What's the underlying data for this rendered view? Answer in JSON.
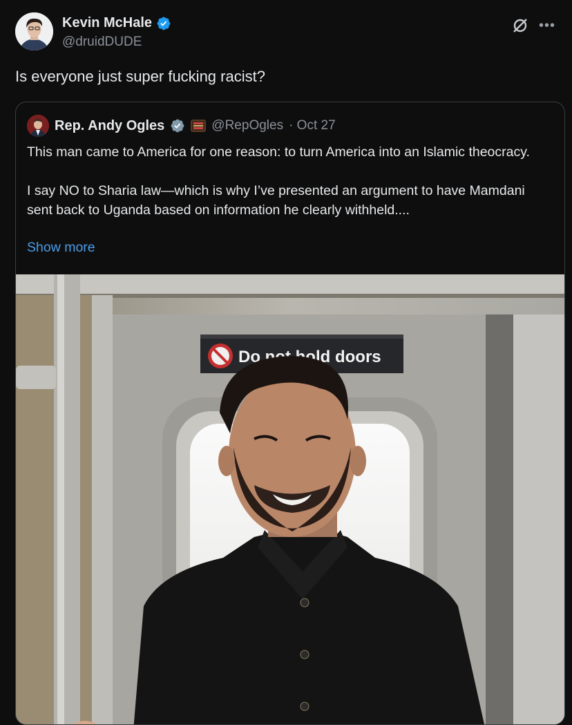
{
  "author": {
    "name": "Kevin McHale",
    "handle": "@druidDUDE"
  },
  "tweet": {
    "text": "Is everyone just super fucking racist?"
  },
  "quoted": {
    "name": "Rep. Andy Ogles",
    "handle": "@RepOgles",
    "date": "· Oct 27",
    "paragraph1": "This man came to America for one reason: to turn America into an Islamic theocracy.",
    "paragraph2": "I say NO to Sharia law—which is why I’ve presented an argument to have Mamdani sent back to Uganda based on information he clearly withheld....",
    "show_more": "Show more",
    "photo_sign": "Do not hold doors"
  },
  "icons": {
    "verified": "verified-badge-icon",
    "grok": "grok-icon",
    "more": "more-options-icon"
  },
  "colors": {
    "accent": "#1d9bf0",
    "link": "#4a9de8",
    "background": "#0e0e0f"
  }
}
